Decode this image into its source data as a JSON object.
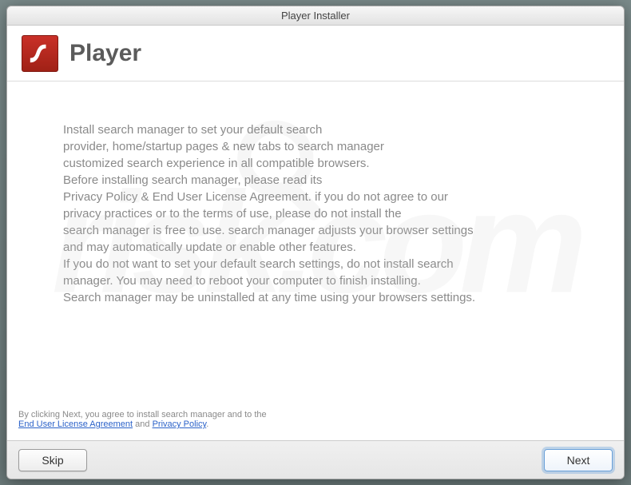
{
  "window": {
    "title": "Player Installer"
  },
  "header": {
    "app_name": "Player"
  },
  "body": {
    "description": "Install search manager to set your default search\nprovider, home/startup pages & new tabs to search manager\ncustomized search experience in all compatible browsers.\nBefore installing search manager, please read its\nPrivacy Policy & End User License Agreement. if you do not agree to our\nprivacy practices or to the terms of use, please do not install the\nsearch manager is free to use. search manager adjusts your browser settings\nand may automatically update or enable other features.\nIf you do not want to set your default search settings, do not install search\nmanager. You may need to reboot your computer to finish installing.\nSearch manager may be uninstalled at any time using your browsers settings."
  },
  "consent": {
    "prefix": "By clicking Next, you agree to install search manager and to the",
    "eula": "End User License Agreement",
    "and": " and ",
    "privacy": "Privacy Policy",
    "suffix": "."
  },
  "buttons": {
    "skip": "Skip",
    "next": "Next"
  }
}
